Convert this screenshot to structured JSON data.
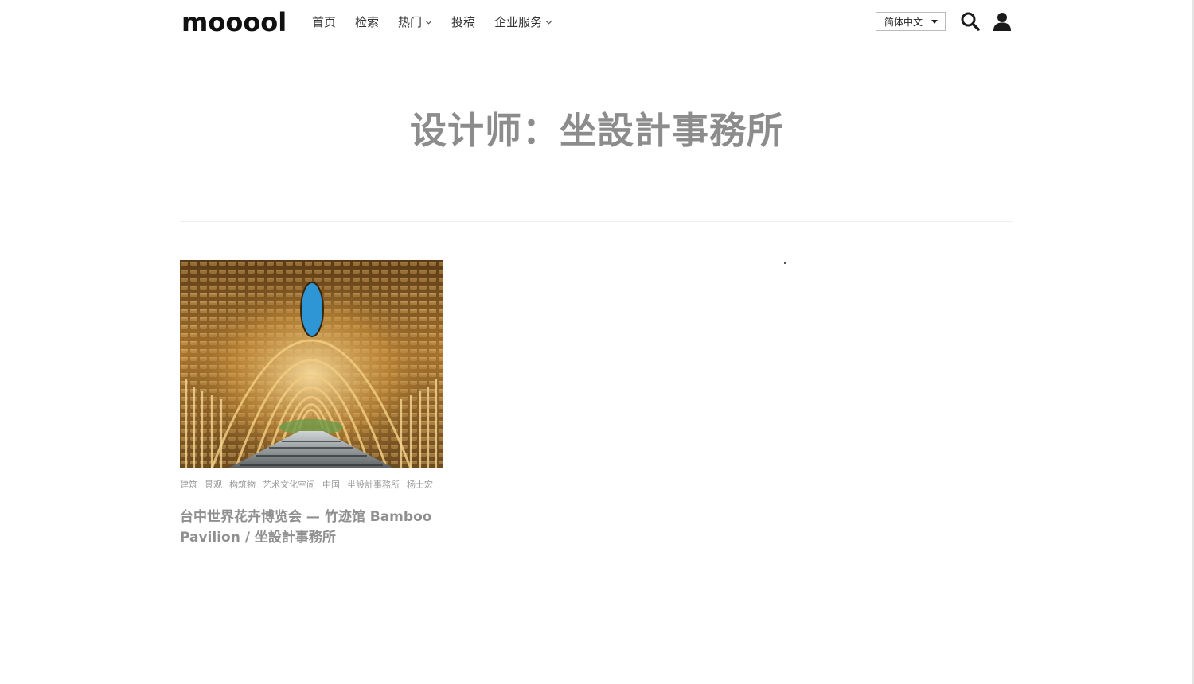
{
  "header": {
    "logo": "mooool",
    "nav": [
      {
        "label": "首页",
        "has_dropdown": false
      },
      {
        "label": "检索",
        "has_dropdown": false
      },
      {
        "label": "热门",
        "has_dropdown": true
      },
      {
        "label": "投稿",
        "has_dropdown": false
      },
      {
        "label": "企业服务",
        "has_dropdown": true
      }
    ],
    "language": "简体中文",
    "icons": [
      "search-icon",
      "user-icon"
    ]
  },
  "main": {
    "page_title": "设计师：坐設計事務所"
  },
  "articles": [
    {
      "tags": [
        "建筑",
        "景观",
        "构筑物",
        "艺术文化空间",
        "中国",
        "坐設計事務所",
        "杨士宏"
      ],
      "title": "台中世界花卉博览会 — 竹迹馆 Bamboo Pavilion / 坐設計事務所"
    }
  ],
  "colors": {
    "title": "#8c8c8c",
    "tag": "#9a9a9a",
    "card_title": "#8f8f8f"
  }
}
